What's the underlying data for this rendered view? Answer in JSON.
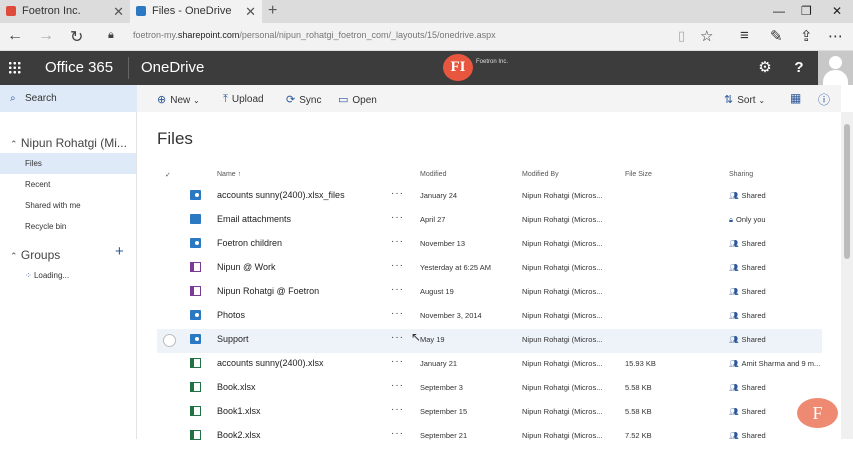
{
  "browser": {
    "tabs": [
      {
        "label": "Foetron Inc.",
        "fav_color": "#e04a3a"
      },
      {
        "label": "Files - OneDrive",
        "fav_color": "#2b79c2"
      }
    ],
    "new_tab": "+",
    "url_prefix": "foetron-my.",
    "url_domain": "sharepoint.com",
    "url_path": "/personal/nipun_rohatgi_foetron_com/_layouts/15/onedrive.aspx",
    "window_controls": [
      "—",
      "❐",
      "✕"
    ]
  },
  "suite": {
    "app": "Office 365",
    "section": "OneDrive",
    "logo_letters": "FI",
    "logo_text": "Foetron Inc."
  },
  "search": {
    "label": "Search"
  },
  "commands": {
    "new": "New",
    "upload": "Upload",
    "sync": "Sync",
    "open": "Open",
    "sort": "Sort"
  },
  "leftnav": {
    "user": "Nipun Rohatgi (Mi...",
    "items": [
      "Files",
      "Recent",
      "Shared with me",
      "Recycle bin"
    ],
    "groups": "Groups",
    "loading": "Loading..."
  },
  "main": {
    "title": "Files",
    "columns": {
      "name": "Name",
      "modified": "Modified",
      "modified_by": "Modified By",
      "size": "File Size",
      "sharing": "Sharing"
    },
    "rows": [
      {
        "name": "accounts sunny(2400).xlsx_files",
        "type": "folder",
        "modified": "January 24",
        "by": "Nipun Rohatgi (Micros...",
        "size": "",
        "sharing": "Shared"
      },
      {
        "name": "Email attachments",
        "type": "folder",
        "modified": "April 27",
        "by": "Nipun Rohatgi (Micros...",
        "size": "",
        "sharing": "Only you"
      },
      {
        "name": "Foetron children",
        "type": "folder",
        "modified": "November 13",
        "by": "Nipun Rohatgi (Micros...",
        "size": "",
        "sharing": "Shared"
      },
      {
        "name": "Nipun @ Work",
        "type": "onenote",
        "modified": "Yesterday at 6:25 AM",
        "by": "Nipun Rohatgi (Micros...",
        "size": "",
        "sharing": "Shared"
      },
      {
        "name": "Nipun Rohatgi @ Foetron",
        "type": "onenote",
        "modified": "August 19",
        "by": "Nipun Rohatgi (Micros...",
        "size": "",
        "sharing": "Shared"
      },
      {
        "name": "Photos",
        "type": "folder",
        "modified": "November 3, 2014",
        "by": "Nipun Rohatgi (Micros...",
        "size": "",
        "sharing": "Shared"
      },
      {
        "name": "Support",
        "type": "folder",
        "modified": "May 19",
        "by": "Nipun Rohatgi (Micros...",
        "size": "",
        "sharing": "Shared"
      },
      {
        "name": "accounts sunny(2400).xlsx",
        "type": "excel",
        "modified": "January 21",
        "by": "Nipun Rohatgi (Micros...",
        "size": "15.93 KB",
        "sharing": "Amit Sharma and 9 m..."
      },
      {
        "name": "Book.xlsx",
        "type": "excel",
        "modified": "September 3",
        "by": "Nipun Rohatgi (Micros...",
        "size": "5.58 KB",
        "sharing": "Shared"
      },
      {
        "name": "Book1.xlsx",
        "type": "excel",
        "modified": "September 15",
        "by": "Nipun Rohatgi (Micros...",
        "size": "5.58 KB",
        "sharing": "Shared"
      },
      {
        "name": "Book2.xlsx",
        "type": "excel",
        "modified": "September 21",
        "by": "Nipun Rohatgi (Micros...",
        "size": "7.52 KB",
        "sharing": "Shared"
      }
    ]
  },
  "floating_logo": "F",
  "colors": {
    "suite_bar": "#3c3c3c",
    "accent": "#2b579a",
    "selection": "#deeaf7"
  }
}
